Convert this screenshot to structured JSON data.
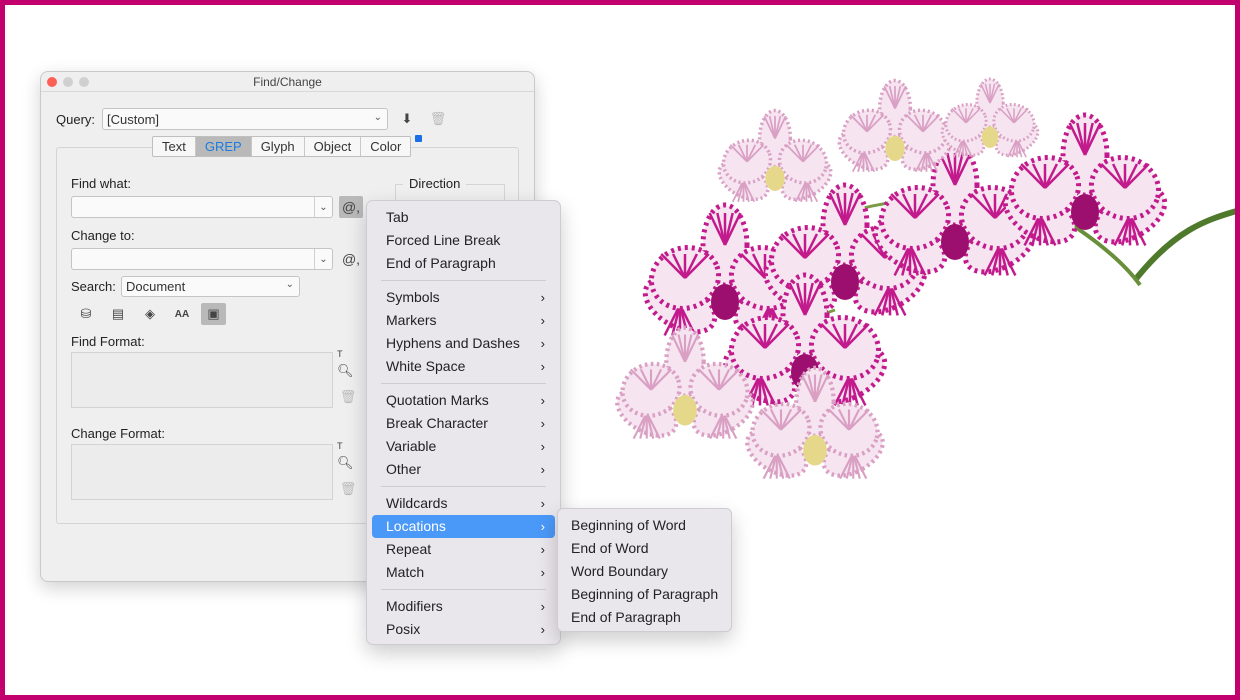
{
  "dialog": {
    "title": "Find/Change",
    "query_label": "Query:",
    "query_value": "[Custom]",
    "tabs": [
      "Text",
      "GREP",
      "Glyph",
      "Object",
      "Color"
    ],
    "active_tab": "GREP",
    "find_what_label": "Find what:",
    "find_what_value": "",
    "change_to_label": "Change to:",
    "change_to_value": "",
    "search_label": "Search:",
    "search_value": "Document",
    "direction_label": "Direction",
    "find_format_label": "Find Format:",
    "change_format_label": "Change Format:",
    "special_char_symbol": "@,"
  },
  "menu": {
    "groups": [
      [
        {
          "label": "Tab"
        },
        {
          "label": "Forced Line Break"
        },
        {
          "label": "End of Paragraph"
        }
      ],
      [
        {
          "label": "Symbols",
          "sub": true
        },
        {
          "label": "Markers",
          "sub": true
        },
        {
          "label": "Hyphens and Dashes",
          "sub": true
        },
        {
          "label": "White Space",
          "sub": true
        }
      ],
      [
        {
          "label": "Quotation Marks",
          "sub": true
        },
        {
          "label": "Break Character",
          "sub": true
        },
        {
          "label": "Variable",
          "sub": true
        },
        {
          "label": "Other",
          "sub": true
        }
      ],
      [
        {
          "label": "Wildcards",
          "sub": true
        },
        {
          "label": "Locations",
          "sub": true,
          "highlighted": true
        },
        {
          "label": "Repeat",
          "sub": true
        },
        {
          "label": "Match",
          "sub": true
        }
      ],
      [
        {
          "label": "Modifiers",
          "sub": true
        },
        {
          "label": "Posix",
          "sub": true
        }
      ]
    ],
    "submenu_arrow": "›"
  },
  "submenu": {
    "items": [
      "Beginning of Word",
      "End of Word",
      "Word Boundary",
      "Beginning of Paragraph",
      "End of Paragraph"
    ]
  },
  "colors": {
    "frame": "#c2006e",
    "highlight": "#4a98f7",
    "active_tab_text": "#1a7ce0",
    "orchid": "#b0127e"
  }
}
